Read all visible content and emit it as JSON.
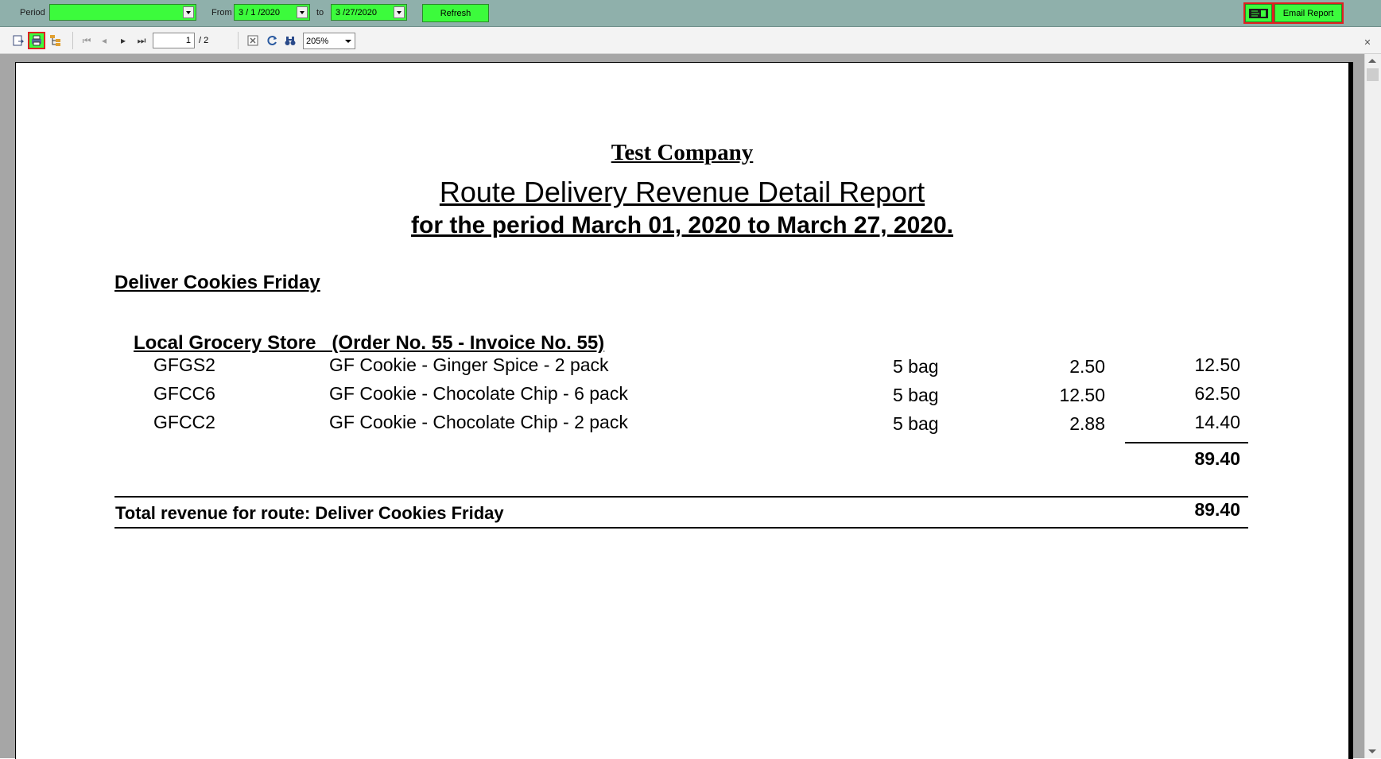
{
  "parameters": {
    "period_label": "Period",
    "period_value": "",
    "from_label": "From",
    "from_value": "3 / 1 /2020",
    "to_label": "to",
    "to_value": "3 /27/2020",
    "refresh_label": "Refresh",
    "email_label": "Email Report"
  },
  "viewer": {
    "page_current": "1",
    "page_total": "/ 2",
    "zoom": "205%"
  },
  "report": {
    "company": "Test Company",
    "title": "Route Delivery Revenue Detail Report",
    "subtitle": "for the period March 01, 2020 to March 27, 2020.",
    "route_name": "Deliver Cookies Friday",
    "customer_header": "Local Grocery Store   (Order No. 55 - Invoice No. 55)",
    "lines": [
      {
        "code": "GFGS2",
        "description": "GF Cookie - Ginger Spice - 2 pack",
        "qty": "5 bag",
        "price": "2.50",
        "amount": "12.50"
      },
      {
        "code": "GFCC6",
        "description": "GF Cookie - Chocolate Chip - 6 pack",
        "qty": "5 bag",
        "price": "12.50",
        "amount": "62.50"
      },
      {
        "code": "GFCC2",
        "description": "GF Cookie - Chocolate Chip - 2 pack",
        "qty": "5 bag",
        "price": "2.88",
        "amount": "14.40"
      }
    ],
    "order_total": "89.40",
    "route_total_label": "Total revenue for route: Deliver Cookies Friday",
    "route_total": "89.40"
  },
  "colors": {
    "param_bar": "#8fb0ab",
    "green_control": "#3cfb3c",
    "highlight_outline": "#e02020",
    "canvas": "#a6a6a6"
  },
  "icons": {
    "export": "export-icon",
    "print": "print-icon",
    "group_tree": "group-tree-icon",
    "first_page": "first-page-icon",
    "prev_page": "prev-page-icon",
    "next_page": "next-page-icon",
    "last_page": "last-page-icon",
    "stop": "stop-icon",
    "refresh": "refresh-icon",
    "search": "search-binoculars-icon",
    "close": "close-icon",
    "email": "email-icon"
  }
}
